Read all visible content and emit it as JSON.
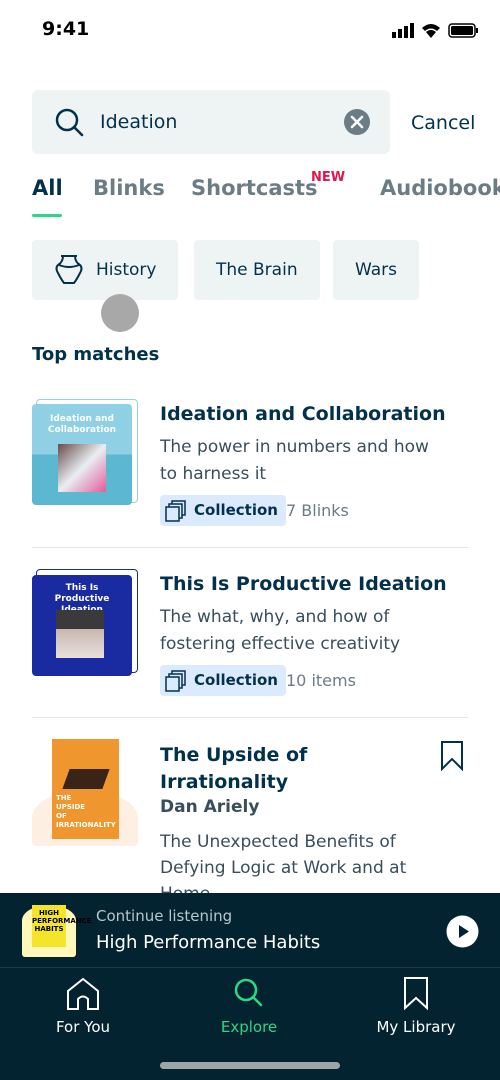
{
  "status_bar": {
    "time": "9:41"
  },
  "search": {
    "query": "Ideation",
    "cancel_label": "Cancel"
  },
  "tabs": [
    {
      "label": "All",
      "active": true
    },
    {
      "label": "Blinks"
    },
    {
      "label": "Shortcasts",
      "badge": "NEW"
    },
    {
      "label": "Audiobooks"
    }
  ],
  "chips": [
    {
      "label": "History",
      "icon": "vase-icon"
    },
    {
      "label": "The Brain"
    },
    {
      "label": "Wars"
    }
  ],
  "section_title": "Top matches",
  "results": [
    {
      "title": "Ideation and Collaboration",
      "description": "The power in numbers and how to harness it",
      "badge": "Collection",
      "count": "7 Blinks",
      "cover_text": "Ideation and Collaboration",
      "cover_color": "#5bb8d0"
    },
    {
      "title": "This Is Productive Ideation",
      "description": "The what, why, and how of fostering effective creativity",
      "badge": "Collection",
      "count": "10 items",
      "cover_text": "This Is Productive Ideation",
      "cover_color": "#1a2aa0"
    },
    {
      "title": "The Upside of Irrationality",
      "author": "Dan Ariely",
      "description": "The Unexpected Benefits of Defying Logic at Work and at Home",
      "cover_text": "THE UPSIDE OF IRRATIONALITY",
      "cover_color": "#f0962e"
    }
  ],
  "player": {
    "label": "Continue listening",
    "title": "High Performance Habits",
    "cover_text": "HIGH PERFORMANCE HABITS"
  },
  "nav": [
    {
      "label": "For You",
      "icon": "home-icon"
    },
    {
      "label": "Explore",
      "icon": "search-icon",
      "active": true
    },
    {
      "label": "My Library",
      "icon": "bookmark-icon"
    }
  ],
  "colors": {
    "accent": "#2bd883",
    "text": "#03314b",
    "new_badge": "#e5144f",
    "dark_bg": "#042330"
  }
}
